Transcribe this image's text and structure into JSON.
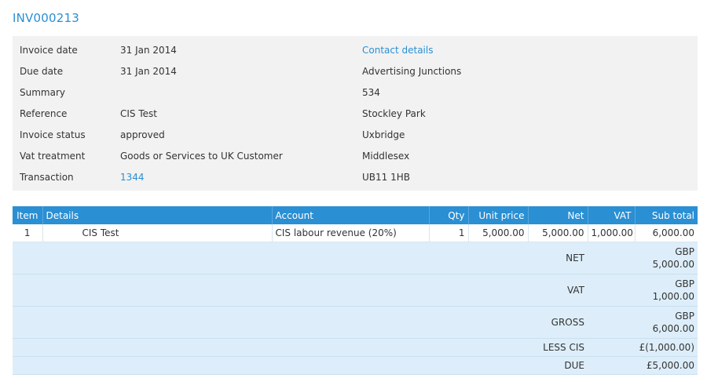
{
  "invoice": {
    "number": "INV000213"
  },
  "details": [
    {
      "label": "Invoice date",
      "value": "31 Jan 2014",
      "is_link": false
    },
    {
      "label": "Due date",
      "value": "31 Jan 2014",
      "is_link": false
    },
    {
      "label": "Summary",
      "value": "",
      "is_link": false
    },
    {
      "label": "Reference",
      "value": "CIS Test",
      "is_link": false
    },
    {
      "label": "Invoice status",
      "value": "approved",
      "is_link": false
    },
    {
      "label": "Vat treatment",
      "value": "Goods or Services to UK Customer",
      "is_link": false
    },
    {
      "label": "Transaction",
      "value": "1344",
      "is_link": true
    }
  ],
  "contact": {
    "link_label": "Contact details",
    "lines": [
      "Advertising Junctions",
      "534",
      "Stockley Park",
      "Uxbridge",
      "Middlesex",
      "UB11 1HB"
    ]
  },
  "table": {
    "headers": {
      "item": "Item",
      "details": "Details",
      "account": "Account",
      "qty": "Qty",
      "unit_price": "Unit price",
      "net": "Net",
      "vat": "VAT",
      "sub_total": "Sub total"
    },
    "rows": [
      {
        "item": "1",
        "details": "CIS Test",
        "account": "CIS labour revenue (20%)",
        "qty": "1",
        "unit_price": "5,000.00",
        "net": "5,000.00",
        "vat": "1,000.00",
        "sub_total": "6,000.00"
      }
    ],
    "totals": {
      "net": {
        "label": "NET",
        "currency": "GBP",
        "amount": "5,000.00"
      },
      "vat": {
        "label": "VAT",
        "currency": "GBP",
        "amount": "1,000.00"
      },
      "gross": {
        "label": "GROSS",
        "currency": "GBP",
        "amount": "6,000.00"
      },
      "less_cis": {
        "label": "LESS CIS",
        "amount": "£(1,000.00)"
      },
      "due": {
        "label": "DUE",
        "amount": "£5,000.00"
      }
    }
  },
  "colors": {
    "accent": "#2a8fd3",
    "panel_bg": "#f2f2f2",
    "totals_bg": "#ddeefa"
  }
}
